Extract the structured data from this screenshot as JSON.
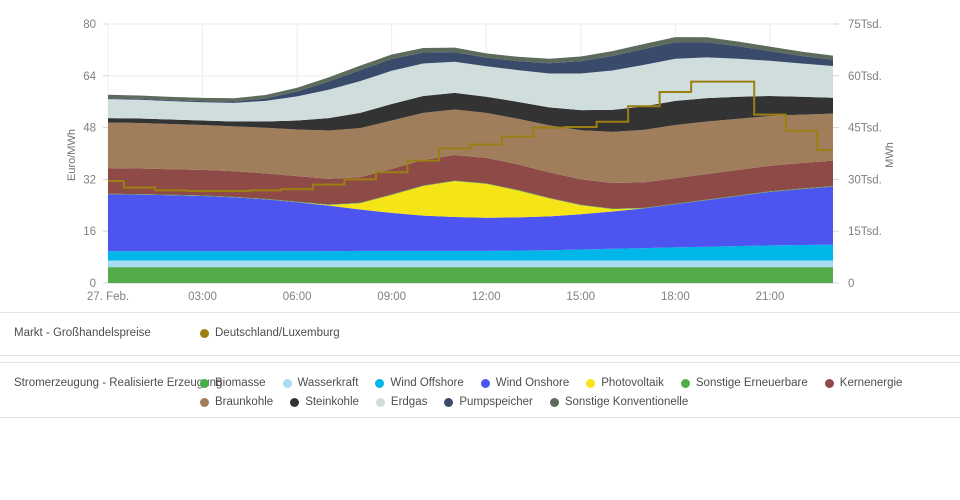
{
  "axes": {
    "left_title": "Euro/MWh",
    "right_title": "MWh",
    "left_ticks": [
      "0",
      "16",
      "32",
      "48",
      "64",
      "80"
    ],
    "right_ticks": [
      "0",
      "15Tsd.",
      "30Tsd.",
      "45Tsd.",
      "60Tsd.",
      "75Tsd."
    ],
    "x_ticks": [
      "27. Feb.",
      "03:00",
      "06:00",
      "09:00",
      "12:00",
      "15:00",
      "18:00",
      "21:00"
    ]
  },
  "legend_market": {
    "title": "Markt - Großhandelspreise",
    "items": [
      {
        "label": "Deutschland/Luxemburg",
        "color": "#9c7f12"
      }
    ]
  },
  "legend_generation": {
    "title": "Stromerzeugung - Realisierte Erzeugung",
    "items": [
      {
        "label": "Biomasse",
        "color": "#3faf46"
      },
      {
        "label": "Wasserkraft",
        "color": "#a8dcf0"
      },
      {
        "label": "Wind Offshore",
        "color": "#00b6e8"
      },
      {
        "label": "Wind Onshore",
        "color": "#4d54f0"
      },
      {
        "label": "Photovoltaik",
        "color": "#f5e416"
      },
      {
        "label": "Sonstige Erneuerbare",
        "color": "#54ab4c"
      },
      {
        "label": "Kernenergie",
        "color": "#8d4a47"
      },
      {
        "label": "Braunkohle",
        "color": "#a07e5c"
      },
      {
        "label": "Steinkohle",
        "color": "#333333"
      },
      {
        "label": "Erdgas",
        "color": "#cfdedc"
      },
      {
        "label": "Pumpspeicher",
        "color": "#3a4a6b"
      },
      {
        "label": "Sonstige Konventionelle",
        "color": "#5d6b5c"
      }
    ]
  },
  "chart_data": {
    "type": "area",
    "title": "",
    "xlabel": "",
    "ylabel": "Euro/MWh",
    "y2label": "MWh",
    "ylim": [
      0,
      80
    ],
    "y2lim": [
      0,
      75000
    ],
    "grid": true,
    "legend_position": "bottom",
    "x": [
      "00:00",
      "01:00",
      "02:00",
      "03:00",
      "04:00",
      "05:00",
      "06:00",
      "07:00",
      "08:00",
      "09:00",
      "10:00",
      "11:00",
      "12:00",
      "13:00",
      "14:00",
      "15:00",
      "16:00",
      "17:00",
      "18:00",
      "19:00",
      "20:00",
      "21:00",
      "22:00",
      "23:00"
    ],
    "x_tick_labels": [
      "27. Feb.",
      "03:00",
      "06:00",
      "09:00",
      "12:00",
      "15:00",
      "18:00",
      "21:00"
    ],
    "stacked_series": [
      {
        "name": "Biomasse",
        "color": "#54ab4c",
        "unit": "MWh",
        "values": [
          4600,
          4600,
          4600,
          4600,
          4600,
          4600,
          4600,
          4600,
          4600,
          4600,
          4600,
          4600,
          4600,
          4600,
          4600,
          4600,
          4600,
          4600,
          4600,
          4600,
          4600,
          4600,
          4600,
          4600
        ]
      },
      {
        "name": "Wasserkraft",
        "color": "#a8dcf0",
        "unit": "MWh",
        "values": [
          1900,
          1900,
          1900,
          1900,
          1900,
          1900,
          1900,
          1900,
          1900,
          1900,
          1900,
          1900,
          1900,
          1900,
          1900,
          1900,
          1900,
          1900,
          1900,
          1900,
          1900,
          1900,
          1900,
          1900
        ]
      },
      {
        "name": "Wind Offshore",
        "color": "#00b6e8",
        "unit": "MWh",
        "values": [
          2700,
          2700,
          2700,
          2700,
          2700,
          2700,
          2700,
          2700,
          2800,
          2800,
          2800,
          2800,
          2800,
          2900,
          3000,
          3200,
          3400,
          3600,
          3800,
          4000,
          4200,
          4400,
          4500,
          4600
        ]
      },
      {
        "name": "Wind Onshore",
        "color": "#4d54f0",
        "unit": "MWh",
        "values": [
          16500,
          16400,
          16200,
          16000,
          15600,
          15000,
          14200,
          13200,
          12000,
          11000,
          10200,
          9800,
          9600,
          9600,
          9800,
          10200,
          10800,
          11500,
          12500,
          13500,
          14500,
          15500,
          16200,
          16800
        ]
      },
      {
        "name": "Photovoltaik",
        "color": "#f5e416",
        "unit": "MWh",
        "values": [
          0,
          0,
          0,
          0,
          0,
          0,
          0,
          200,
          1800,
          5200,
          8600,
          10400,
          9800,
          7800,
          5200,
          2600,
          700,
          0,
          0,
          0,
          0,
          0,
          0,
          0
        ]
      },
      {
        "name": "Sonstige Erneuerbare",
        "color": "#54ab4c",
        "unit": "MWh",
        "values": [
          150,
          150,
          150,
          150,
          150,
          150,
          150,
          150,
          150,
          150,
          150,
          150,
          150,
          150,
          150,
          150,
          150,
          150,
          150,
          150,
          150,
          150,
          150,
          150
        ]
      },
      {
        "name": "Kernenergie",
        "color": "#8d4a47",
        "unit": "MWh",
        "values": [
          7400,
          7400,
          7400,
          7400,
          7400,
          7400,
          7400,
          7400,
          7400,
          7400,
          7400,
          7400,
          7400,
          7400,
          7400,
          7400,
          7400,
          7400,
          7400,
          7400,
          7400,
          7400,
          7400,
          7400
        ]
      },
      {
        "name": "Braunkohle",
        "color": "#a07e5c",
        "unit": "MWh",
        "values": [
          13200,
          13200,
          13100,
          13000,
          13000,
          13200,
          13500,
          14000,
          14200,
          14000,
          13600,
          13200,
          13000,
          13200,
          13600,
          14200,
          14800,
          15200,
          15400,
          15200,
          14800,
          14400,
          14000,
          13600
        ]
      },
      {
        "name": "Steinkohle",
        "color": "#333333",
        "unit": "MWh",
        "values": [
          1300,
          1300,
          1300,
          1300,
          1400,
          1800,
          2600,
          3600,
          4400,
          4800,
          4900,
          4800,
          4700,
          4900,
          5200,
          5800,
          6400,
          6800,
          7000,
          6800,
          6400,
          5800,
          5200,
          4600
        ]
      },
      {
        "name": "Erdgas",
        "color": "#cfdedc",
        "unit": "MWh",
        "values": [
          5500,
          5400,
          5300,
          5300,
          5400,
          6000,
          7000,
          8200,
          9200,
          9600,
          9400,
          9000,
          8800,
          9200,
          9800,
          10600,
          11400,
          12000,
          12200,
          11800,
          11000,
          10200,
          9600,
          9200
        ]
      },
      {
        "name": "Pumpspeicher",
        "color": "#3a4a6b",
        "unit": "MWh",
        "values": [
          300,
          300,
          300,
          300,
          400,
          700,
          1400,
          2400,
          3200,
          3400,
          3200,
          2800,
          2500,
          2600,
          3000,
          3600,
          4200,
          4600,
          4800,
          4400,
          3600,
          2800,
          2200,
          1800
        ]
      },
      {
        "name": "Sonstige Konventionelle",
        "color": "#5d6b5c",
        "unit": "MWh",
        "values": [
          950,
          950,
          950,
          950,
          950,
          1000,
          1100,
          1200,
          1300,
          1300,
          1300,
          1300,
          1250,
          1250,
          1300,
          1350,
          1400,
          1450,
          1450,
          1400,
          1350,
          1300,
          1250,
          1200
        ]
      }
    ],
    "line_series": {
      "name": "Deutschland/Luxemburg",
      "color": "#9c7f12",
      "unit": "Euro/MWh",
      "style": "step",
      "values": [
        31.5,
        29.5,
        28.6,
        28.4,
        28.4,
        28.6,
        29.0,
        30.4,
        32.0,
        34.2,
        37.8,
        41.6,
        42.8,
        45.2,
        48.0,
        48.2,
        49.8,
        54.6,
        59.0,
        62.2,
        62.2,
        52.0,
        47.0,
        41.0
      ]
    }
  }
}
